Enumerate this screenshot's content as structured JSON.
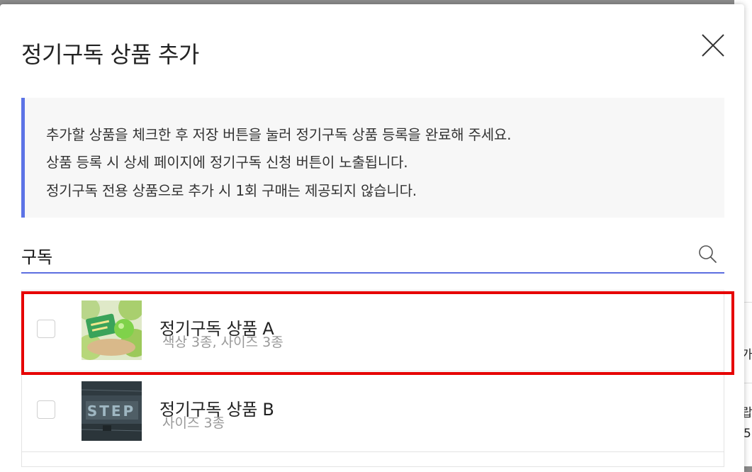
{
  "modal": {
    "title": "정기구독 상품 추가"
  },
  "notice": {
    "lines": [
      "추가할 상품을 체크한 후 저장 버튼을 눌러 정기구독 상품 등록을 완료해 주세요.",
      "상품 등록 시 상세 페이지에 정기구독 신청 버튼이 노출됩니다.",
      "정기구독 전용 상품으로 추가 시 1회 구매는 제공되지 않습니다."
    ]
  },
  "search": {
    "value": "구독",
    "icon": "search-icon"
  },
  "products": [
    {
      "name": "정기구독 상품 A",
      "options": "색상 3종, 사이즈 3종",
      "checked": false
    },
    {
      "name": "정기구독 상품 B",
      "options": "사이즈 3종",
      "checked": false
    }
  ],
  "background": {
    "fragments": [
      "가",
      "랍",
      "5"
    ]
  },
  "colors": {
    "accent": "#5c6ee0",
    "highlight": "#e60000"
  }
}
